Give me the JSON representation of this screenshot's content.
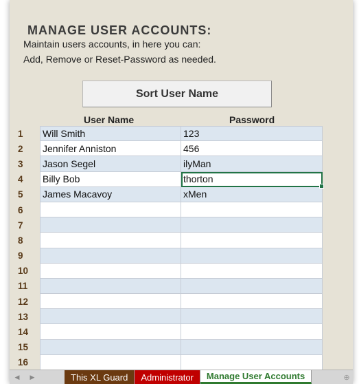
{
  "header": {
    "title": "MANAGE USER ACCOUNTS:",
    "line1": "Maintain users accounts, in here you can:",
    "line2": "Add, Remove or Reset-Password as needed."
  },
  "sort_button": "Sort User Name",
  "columns": {
    "user": "User Name",
    "password": "Password"
  },
  "rows": [
    {
      "num": "1",
      "user": "Will Smith",
      "password": "123"
    },
    {
      "num": "2",
      "user": "Jennifer Anniston",
      "password": "456"
    },
    {
      "num": "3",
      "user": "Jason Segel",
      "password": "ilyMan"
    },
    {
      "num": "4",
      "user": "Billy Bob",
      "password": "thorton"
    },
    {
      "num": "5",
      "user": "James Macavoy",
      "password": "xMen"
    },
    {
      "num": "6",
      "user": "",
      "password": ""
    },
    {
      "num": "7",
      "user": "",
      "password": ""
    },
    {
      "num": "8",
      "user": "",
      "password": ""
    },
    {
      "num": "9",
      "user": "",
      "password": ""
    },
    {
      "num": "10",
      "user": "",
      "password": ""
    },
    {
      "num": "11",
      "user": "",
      "password": ""
    },
    {
      "num": "12",
      "user": "",
      "password": ""
    },
    {
      "num": "13",
      "user": "",
      "password": ""
    },
    {
      "num": "14",
      "user": "",
      "password": ""
    },
    {
      "num": "15",
      "user": "",
      "password": ""
    },
    {
      "num": "16",
      "user": "",
      "password": ""
    }
  ],
  "tabs": [
    {
      "label": "This XL Guard",
      "style": "brown"
    },
    {
      "label": "Administrator",
      "style": "red"
    },
    {
      "label": "Manage User Accounts",
      "style": "active"
    }
  ],
  "icons": {
    "nav_prev": "left-arrow-icon",
    "nav_next": "right-arrow-icon",
    "add_sheet": "plus-icon"
  },
  "colors": {
    "band": "#dce6f0",
    "rownum": "#5a3b1a",
    "selected": "#217346",
    "tab_brown": "#6b3a10",
    "tab_red": "#c00000",
    "tab_active_text": "#2f7a2f"
  }
}
